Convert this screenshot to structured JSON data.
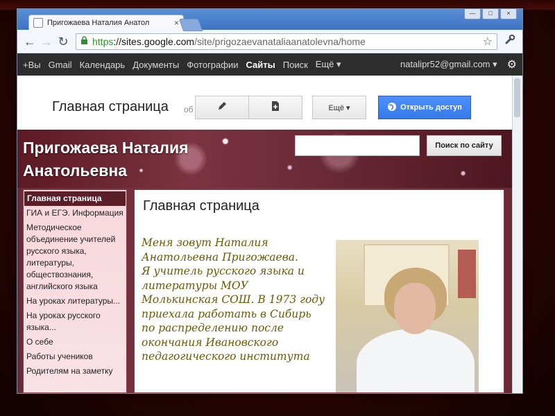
{
  "browser": {
    "tab_title": "Пригожаева Наталия Анатол",
    "tab_close": "×",
    "window_controls": [
      "—",
      "□",
      "×"
    ],
    "nav": {
      "back": "←",
      "forward": "→",
      "reload": "↻"
    },
    "url": {
      "scheme": "https",
      "host": "://sites.google.com",
      "path": "/site/prigozaevanataliaanatolevna/home"
    },
    "icons": {
      "lock": "lock-icon",
      "star": "star-icon",
      "wrench": "wrench-icon"
    }
  },
  "google_bar": {
    "items": [
      "+Вы",
      "Gmail",
      "Календарь",
      "Документы",
      "Фотографии",
      "Сайты",
      "Поиск",
      "Ещё ▾"
    ],
    "active": "Сайты",
    "email": "natalipr52@gmail.com ▾"
  },
  "sites_toolbar": {
    "page_heading": "Главная страница",
    "truncated": "об",
    "more_label": "Ещё ▾",
    "share_label": "Открыть доступ"
  },
  "site": {
    "title_line1": "Пригожаева Наталия",
    "title_line2": "Анатольевна",
    "search_button": "Поиск по сайту",
    "search_value": ""
  },
  "sidebar": {
    "items": [
      "Главная страница",
      "ГИА и ЕГЭ. Информация",
      "Методическое объединение учителей русского языка, литературы, обществознания, английского языка",
      "На уроках литературы...",
      "На уроках русского языка...",
      "О себе",
      "Работы учеников",
      "Родителям на заметку"
    ]
  },
  "main": {
    "title": "Главная страница",
    "intro": "Меня зовут Наталия Анатольевна Пригожаева.\n   Я учитель русского языка и литературы МОУ Молькинская СОШ. В 1973 году приехала работать в Сибирь по распределению после окончания Ивановского педагогического института"
  },
  "colors": {
    "accent": "#4d90fe",
    "gbar_bg": "#2d2d2d",
    "banner": "#6a2a37",
    "sidebar_active": "#5a1e28"
  }
}
